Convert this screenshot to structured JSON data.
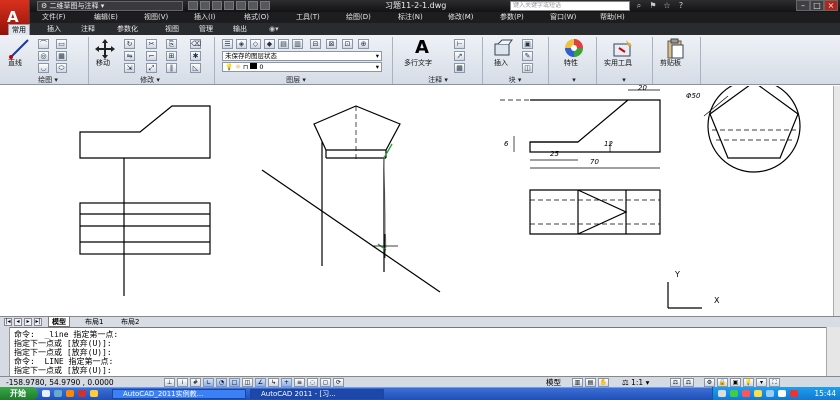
{
  "titlebar": {
    "workspace": "二维草图与注释",
    "document_title": "习题11-2-1.dwg",
    "search_placeholder": "键入关键字或短语"
  },
  "menus": [
    "文件(F)",
    "编辑(E)",
    "视图(V)",
    "插入(I)",
    "格式(O)",
    "工具(T)",
    "绘图(D)",
    "标注(N)",
    "修改(M)",
    "参数(P)",
    "窗口(W)",
    "帮助(H)"
  ],
  "ribbon_tabs": [
    "常用",
    "插入",
    "注释",
    "参数化",
    "视图",
    "管理",
    "输出"
  ],
  "ribbon": {
    "draw_panel": "绘图",
    "modify_panel": "修改",
    "layers_panel": "图层",
    "annotation_panel": "注释",
    "block_panel": "块",
    "line_label": "直线",
    "move_label": "移动",
    "layer_state": "未保存的图层状态",
    "layer_current": "0",
    "mtext_label": "多行文字",
    "insert_label": "插入",
    "properties_label": "特性",
    "utilities_label": "实用工具",
    "clipboard_label": "剪贴板"
  },
  "drawing": {
    "dim_20": "20",
    "dim_6": "6",
    "dim_12": "12",
    "dim_25": "25",
    "dim_70": "70",
    "dim_phi50": "Φ50",
    "ucs_y": "Y",
    "ucs_x": "X"
  },
  "layout_tabs": [
    "模型",
    "布局1",
    "布局2"
  ],
  "command_lines": [
    "命令:  _line 指定第一点:",
    "指定下一点或 [放弃(U)]:",
    "指定下一点或 [放弃(U)]:",
    "命令:  LINE 指定第一点:",
    "指定下一点或 [放弃(U)]:"
  ],
  "status": {
    "coords": "-158.9780, 54.9790 , 0.0000",
    "model_label": "模型",
    "scale": "1:1"
  },
  "taskbar": {
    "start": "开始",
    "tasks": [
      "AutoCAD_2011实例教...",
      "AutoCAD 2011 - [习..."
    ],
    "clock": "15:44"
  }
}
